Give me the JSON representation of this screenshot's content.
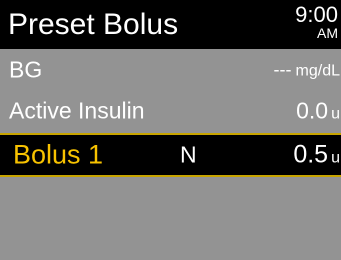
{
  "header": {
    "title": "Preset Bolus",
    "time": "9:00",
    "ampm": "AM"
  },
  "rows": [
    {
      "label": "BG",
      "value": "---",
      "unit": "mg/dL"
    },
    {
      "label": "Active Insulin",
      "value": "0.0",
      "unit": "u"
    },
    {
      "label": "Bolus 1",
      "type": "N",
      "value": "0.5",
      "unit": "u",
      "selected": true
    }
  ],
  "colors": {
    "background": "#939393",
    "title_bar": "#000000",
    "highlight_text": "#f7c200",
    "highlight_border": "#c8a400"
  }
}
